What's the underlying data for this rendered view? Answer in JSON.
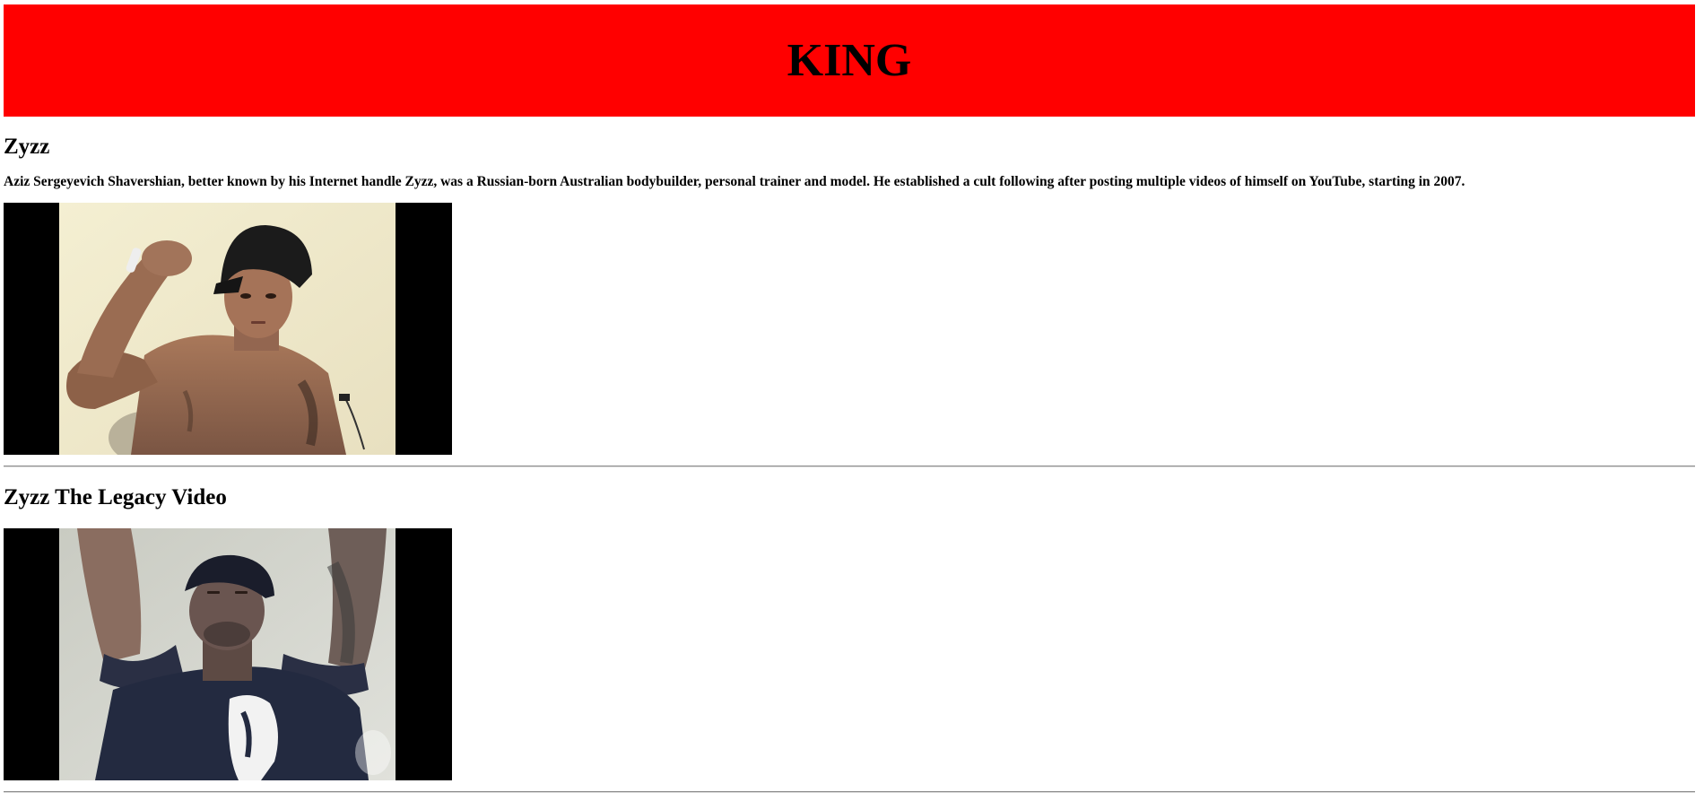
{
  "banner": {
    "title": "KING",
    "background_color": "#ff0000"
  },
  "section1": {
    "heading": "Zyzz",
    "description": "Aziz Sergeyevich Shavershian, better known by his Internet handle Zyzz, was a Russian-born Australian bodybuilder, personal trainer and model. He established a cult following after posting multiple videos of himself on YouTube, starting in 2007."
  },
  "section2": {
    "heading": "Zyzz The Legacy Video"
  }
}
